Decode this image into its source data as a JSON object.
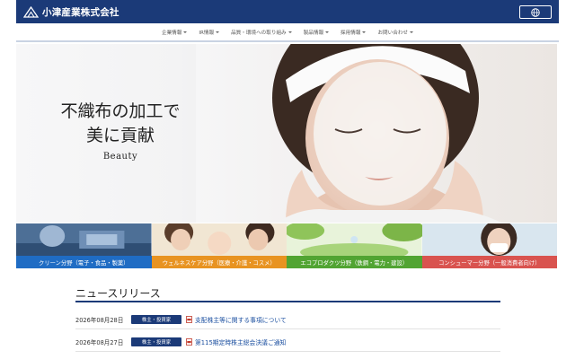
{
  "header": {
    "company_name": "小津産業株式会社",
    "logo_icon": "mountain-logo-icon",
    "language_icon": "globe-icon",
    "colors": {
      "bar": "#1b3a78"
    }
  },
  "nav": {
    "items": [
      {
        "label": "企業情報"
      },
      {
        "label": "IR情報"
      },
      {
        "label": "品質・環境への取り組み"
      },
      {
        "label": "製品情報"
      },
      {
        "label": "採用情報"
      },
      {
        "label": "お問い合わせ"
      }
    ]
  },
  "hero": {
    "line1": "不織布の加工で",
    "line2": "美に貢献",
    "subtitle": "Beauty"
  },
  "categories": [
    {
      "label": "クリーン分野（電子・食品・製薬）",
      "color": "#1f6cc4"
    },
    {
      "label": "ウェルネスケア分野（医療・介護・コスメ）",
      "color": "#e89321"
    },
    {
      "label": "エコプロダクツ分野（鉄鋼・電力・建設）",
      "color": "#51a432"
    },
    {
      "label": "コンシューマー分野（一般消費者向け）",
      "color": "#d9534f"
    }
  ],
  "news": {
    "title": "ニュースリリース",
    "items": [
      {
        "date": "2026年08月28日",
        "tag": "株主・投資家",
        "icon": "pdf-icon",
        "text": "支配株主等に関する事項について"
      },
      {
        "date": "2026年08月27日",
        "tag": "株主・投資家",
        "icon": "pdf-icon",
        "text": "第115期定時株主総会決議ご通知"
      }
    ]
  }
}
